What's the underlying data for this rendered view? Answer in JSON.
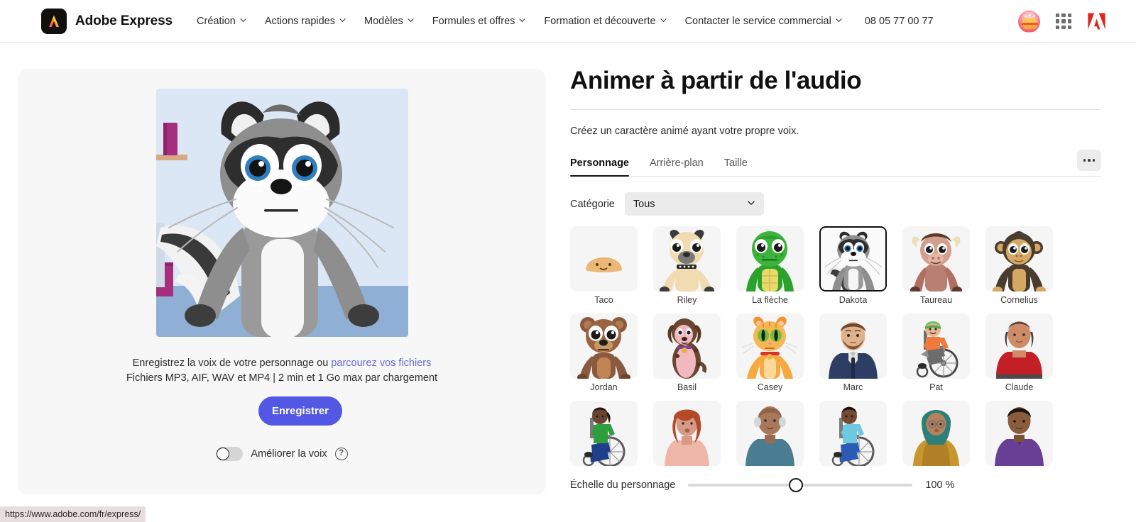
{
  "header": {
    "brand": "Adobe Express",
    "nav_items": [
      {
        "label": "Création",
        "has_chevron": true
      },
      {
        "label": "Actions rapides",
        "has_chevron": true
      },
      {
        "label": "Modèles",
        "has_chevron": true
      },
      {
        "label": "Formules et offres",
        "has_chevron": true
      },
      {
        "label": "Formation et découverte",
        "has_chevron": true
      },
      {
        "label": "Contacter le service commercial",
        "has_chevron": true
      }
    ],
    "phone": "08 05 77 00 77",
    "icons": {
      "avatar": "avatar-burger-icon",
      "app_grid": "app-grid-icon",
      "adobe_logo": "adobe-a-icon"
    }
  },
  "left_panel": {
    "preview_character": "Dakota",
    "upload_line1_prefix": "Enregistrez la voix de votre personnage ou",
    "upload_link": "parcourez vos fichiers",
    "upload_line2": "Fichiers MP3, AIF, WAV et MP4 | 2 min et 1 Go max par chargement",
    "record_button": "Enregistrer",
    "enhance_label": "Améliorer la voix",
    "enhance_enabled": false,
    "help_glyph": "?"
  },
  "right_panel": {
    "title": "Animer à partir de l'audio",
    "subtitle": "Créez un caractère animé ayant votre propre voix.",
    "tabs": [
      {
        "label": "Personnage",
        "active": true
      },
      {
        "label": "Arrière-plan",
        "active": false
      },
      {
        "label": "Taille",
        "active": false
      }
    ],
    "more_button": "overflow-menu",
    "category_label": "Catégorie",
    "category_value": "Tous",
    "scale_label": "Échelle du personnage",
    "scale_value": "100 %",
    "scale_percent": 48,
    "characters": [
      {
        "name": "Taco",
        "selected": false,
        "type": "taco"
      },
      {
        "name": "Riley",
        "selected": false,
        "type": "dog"
      },
      {
        "name": "La flèche",
        "selected": false,
        "type": "turtle"
      },
      {
        "name": "Dakota",
        "selected": true,
        "type": "raccoon"
      },
      {
        "name": "Taureau",
        "selected": false,
        "type": "bull"
      },
      {
        "name": "Cornelius",
        "selected": false,
        "type": "monkey"
      },
      {
        "name": "Jordan",
        "selected": false,
        "type": "bear"
      },
      {
        "name": "Basil",
        "selected": false,
        "type": "puppy"
      },
      {
        "name": "Casey",
        "selected": false,
        "type": "cat"
      },
      {
        "name": "Marc",
        "selected": false,
        "type": "man-beard"
      },
      {
        "name": "Pat",
        "selected": false,
        "type": "wheelchair-green"
      },
      {
        "name": "Claude",
        "selected": false,
        "type": "woman-red"
      },
      {
        "name": "",
        "selected": false,
        "type": "wheelchair-green2"
      },
      {
        "name": "",
        "selected": false,
        "type": "woman-ginger"
      },
      {
        "name": "",
        "selected": false,
        "type": "elder-blue"
      },
      {
        "name": "",
        "selected": false,
        "type": "wheelchair-blue"
      },
      {
        "name": "",
        "selected": false,
        "type": "hijab-teal"
      },
      {
        "name": "",
        "selected": false,
        "type": "man-purple"
      }
    ]
  },
  "status_bar": {
    "url": "https://www.adobe.com/fr/express/"
  },
  "colors": {
    "accent": "#5258e4",
    "link": "#6767de",
    "panel_bg": "#f7f7f7",
    "selected_border": "#0f0f0f",
    "adobe_red": "#e1251b"
  }
}
